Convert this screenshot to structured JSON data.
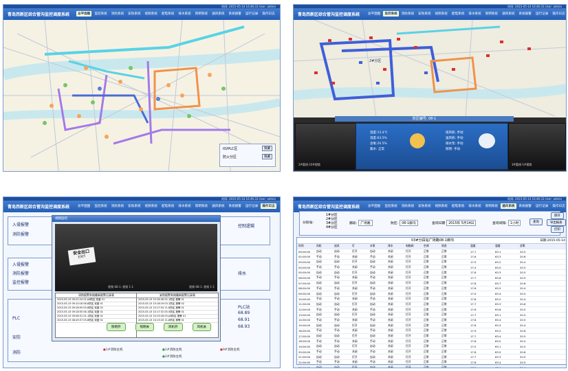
{
  "app": {
    "title": "青岛西新区综合管沟监控调度系统",
    "user_info": "时间: 2015-05-14 16:46:33    User: admin"
  },
  "menu": [
    "总平面图",
    "监控系统",
    "消防系统",
    "安防系统",
    "视频系统",
    "配电系统",
    "排水系统",
    "照明系统",
    "通风系统",
    "系统报警",
    "运行记录",
    "操作日志"
  ],
  "panel1": {
    "active_menu": 0,
    "legend_rows": [
      {
        "label": "IO/PLC区",
        "button": "隐藏"
      },
      {
        "label": "防火分区",
        "button": "隐藏"
      }
    ]
  },
  "panel2": {
    "active_menu": 1,
    "zone_label": "2#分区",
    "sensor_title": "防区编号: 08-1",
    "sensor_values": [
      "温度:13.4℃",
      "湿度:63.5%",
      "含氧:20.5%",
      "集水: 正常"
    ],
    "sensor_status": [
      "排风机: 手动",
      "送风机: 手动",
      "排水泵: 手动",
      "照明: 手动"
    ],
    "video_captions": [
      "2#管线-10#视频",
      "3#管线-1#视频"
    ]
  },
  "panel3": {
    "active_menu": 11,
    "dialog_title": "视频监控",
    "dialog_cam_labels": [
      "视频-08-1: 视频 1-1",
      "视频-08-1: 视频 1-1"
    ],
    "exit_sign": "安全出口",
    "exit_sign_en": "EXIT",
    "left_table_title": "消防报警系统最新报警记录表",
    "right_table_title": "安防报警系统最新报警记录表",
    "left_table_rows": [
      "2015-05-15 09:22:24  02-A8防区  双鉴  01",
      "2015-05-15 09:10:18  06-8防区  双鉴  01",
      "2015-05-15 09:18:59  05-8防区  双鉴  02",
      "2015-05-15 09:18:55  06-1防区  双鉴  01",
      "2015-05-15 09:08:31  01-1防区  双鉴  01",
      "2015-05-15 08:49:37  05-8防区  双鉴  01"
    ],
    "right_table_rows": [
      "2015-05-15 10:18:36  02-1防区  报警  01",
      "2015-05-15 10:18:19  03-1防区  报警  02",
      "2015-05-15 10:17:54  11-8防区  报警  01",
      "2015-05-15 10:17:32  05-5防区  报警  01",
      "2015-05-15 10:15:26  03-A8防区  报警  01",
      "2015-05-15 10:13:43  11-8防区  报警  01"
    ],
    "bg_labels": [
      "入侵报警",
      "消防报警",
      "入侵报警",
      "消防报警",
      "监控报警",
      "PLC",
      "安防",
      "消防"
    ],
    "right_labels": [
      "控制逻辑",
      "排水",
      "PLC站",
      "68.89",
      "68.91",
      "68.93"
    ],
    "action_buttons": [
      "照明开",
      "照明关",
      "风机开",
      "风机关"
    ],
    "footer_items": [
      "1#消防主机",
      "1#消防主机",
      "2#消防主机",
      "9#消防主机"
    ]
  },
  "panel4": {
    "active_menu": 8,
    "zone_options": [
      "1#分区",
      "2#分区",
      "3#分区",
      "4#分区"
    ],
    "field_labels": {
      "zone": "分段站:",
      "tunnel": "廊段:",
      "section": "防区:",
      "date": "查询日期",
      "interval": "查询间隔:"
    },
    "field_values": {
      "tunnel": "广场路",
      "section": "08-1廊沟",
      "date": "2015年 5月14日",
      "interval": "1小时"
    },
    "search_button": "查询",
    "side_buttons": [
      "保存",
      "导出报表",
      "打印"
    ],
    "date_label": "日期:2015-05-14",
    "grid_title": "03#分段站广场路08-1廊沟",
    "grid_headers": [
      "时间",
      "风机",
      "送风",
      "灯",
      "水泵",
      "排水",
      "电磁阀",
      "空调",
      "状态",
      "温度",
      "湿度",
      "含氧"
    ],
    "grid_times": [
      "09:00:00",
      "02:00:00",
      "03:00:00",
      "04:00:00",
      "05:00:00",
      "06:00:00",
      "07:00:00",
      "08:00:00",
      "09:00:00",
      "10:00:00",
      "11:00:00",
      "12:00:00",
      "13:00:00",
      "14:00:00",
      "15:00:00",
      "16:00:00",
      "17:00:00",
      "18:00:00",
      "19:00:00",
      "20:00:00",
      "21:00:00",
      "22:00:00",
      "23:00:00"
    ],
    "grid_status": [
      "自动",
      "手动",
      "打开",
      "关闭",
      "正常",
      "报警",
      "正常",
      "未处理"
    ],
    "grid_temp": [
      "17.7",
      "17.6",
      "17.5",
      "17.4",
      "17.6",
      "17.7",
      "17.8",
      "17.6",
      "17.9",
      "17.8",
      "17.7",
      "17.6",
      "17.7",
      "17.8",
      "17.6",
      "17.9",
      "17.7",
      "17.8",
      "17.5",
      "17.6",
      "17.7",
      "17.6",
      "17.5"
    ],
    "grid_humid": [
      "63.1",
      "63.3",
      "63.2",
      "63.0",
      "63.3",
      "63.6",
      "63.7",
      "63.5",
      "63.4",
      "63.2",
      "63.3",
      "63.6",
      "63.1",
      "63.4",
      "63.3",
      "63.2",
      "63.4",
      "63.0",
      "63.1",
      "63.5",
      "63.3",
      "63.4",
      "63.1"
    ],
    "grid_oxygen": [
      "20.5",
      "20.6",
      "20.4",
      "20.5",
      "20.5",
      "20.5",
      "20.6",
      "20.4",
      "20.5",
      "20.4",
      "20.6",
      "20.5",
      "20.5",
      "20.5",
      "20.4",
      "20.6",
      "20.5",
      "20.4",
      "20.5",
      "20.6",
      "20.5",
      "20.5",
      "20.4"
    ]
  },
  "colors": {
    "titlebar": "#2f6cc4",
    "menu_active": "#fffbcf",
    "pipe_cyan": "#59d2e6",
    "pipe_blue": "#4b6bd6",
    "pipe_purple": "#a479e8",
    "pipe_orange": "#f0924a"
  }
}
